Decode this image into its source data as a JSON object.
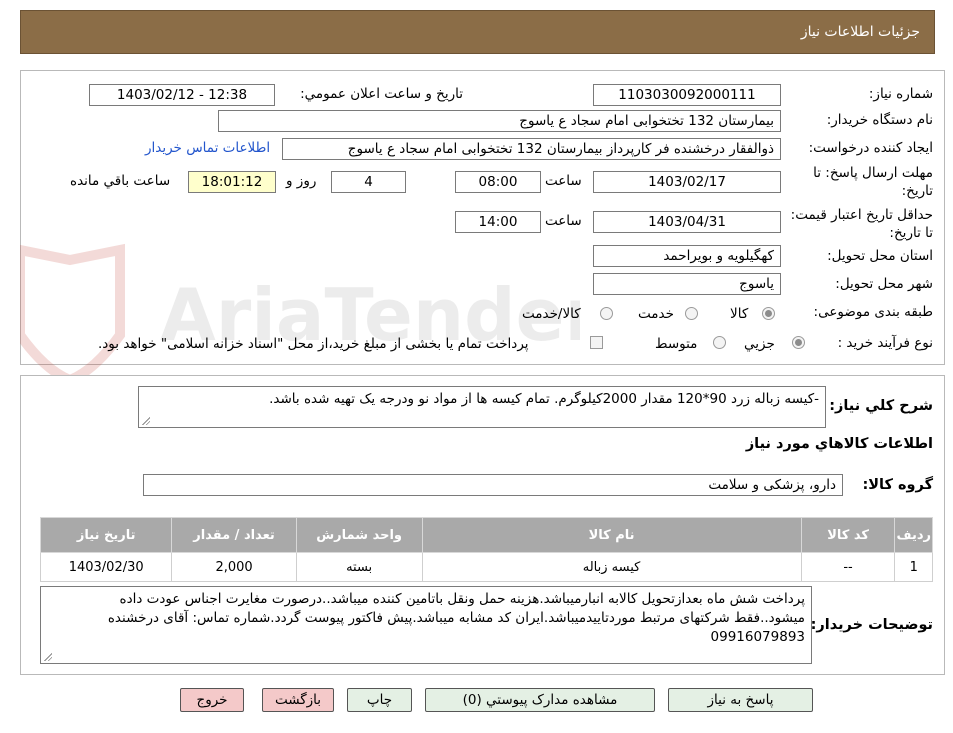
{
  "header": {
    "title": "جزئيات اطلاعات نياز"
  },
  "form": {
    "need_number_label": "شماره نياز:",
    "need_number": "1103030092000111",
    "announce_label": "تاريخ و ساعت اعلان عمومي:",
    "announce_value": "1403/02/12 - 12:38",
    "buyer_org_label": "نام دستگاه خريدار:",
    "buyer_org": "بیمارستان 132 تختخوابی امام سجاد  ع  یاسوج",
    "creator_label": "ايجاد کننده درخواست:",
    "creator": "ذوالفقار درخشنده فر کارپرداز بیمارستان 132 تختخوابی امام سجاد  ع  یاسوج",
    "contact_link": "اطلاعات تماس خريدار",
    "reply_deadline_label": "مهلت ارسال پاسخ: تا تاريخ:",
    "reply_date": "1403/02/17",
    "time_label": "ساعت",
    "reply_time": "08:00",
    "days_remaining": "4",
    "days_label": "روز و",
    "remaining_time": "18:01:12",
    "remaining_label": "ساعت باقي مانده",
    "price_validity_label": "حداقل تاريخ اعتبار قيمت: تا تاريخ:",
    "validity_date": "1403/04/31",
    "validity_time": "14:00",
    "province_label": "استان محل تحويل:",
    "province": "کهگیلویه و بویراحمد",
    "city_label": "شهر محل تحويل:",
    "city": "یاسوج",
    "category_label": "طبقه بندی موضوعی:",
    "category_options": [
      "کالا",
      "خدمت",
      "کالا/خدمت"
    ],
    "process_label": "نوع فرآيند خريد :",
    "process_options": [
      "جزيي",
      "متوسط"
    ],
    "payment_note": "پرداخت تمام یا بخشی از مبلغ خرید،از محل \"اسناد خزانه اسلامی\" خواهد بود."
  },
  "summary": {
    "label": "شرح کلي نياز:",
    "text": "-کیسه زباله زرد 90*120 مقدار 2000کیلوگرم. تمام کیسه ها از مواد نو ودرجه یک تهیه شده باشد.",
    "goods_info_title": "اطلاعات کالاهاي مورد نياز",
    "group_label": "گروه کالا:",
    "group_value": "دارو، پزشکی و سلامت"
  },
  "table": {
    "headers": [
      "رديف",
      "کد کالا",
      "نام کالا",
      "واحد شمارش",
      "تعداد / مقدار",
      "تاريخ نياز"
    ],
    "rows": [
      [
        "1",
        "--",
        "کیسه زباله",
        "بسته",
        "2,000",
        "1403/02/30"
      ]
    ]
  },
  "notes": {
    "label": "توضيحات خريدار:",
    "text": "پرداخت شش ماه بعدازتحویل کالابه انبارمیباشد.هزینه حمل ونقل باتامین کننده میباشد..درصورت مغایرت اجناس عودت داده میشود..فقط شرکتهای مرتبط موردتاییدمیباشد.ایران کد مشابه میباشد.پیش فاکتور پیوست گردد.شماره تماس: آقای درخشنده 09916079893"
  },
  "buttons": {
    "reply": "پاسخ به نياز",
    "attachments": "مشاهده مدارک پيوستي (0)",
    "print": "چاپ",
    "back": "بازگشت",
    "exit": "خروج"
  },
  "colors": {
    "header_bg": "#8b6d47",
    "table_header_bg": "#a9a9a9",
    "link": "#2255cc",
    "remaining_bg": "#ffffcc",
    "button_green": "#e4f0e4",
    "button_red": "#f4c9c9"
  },
  "watermark": {
    "text": "AriaTender.neT"
  }
}
